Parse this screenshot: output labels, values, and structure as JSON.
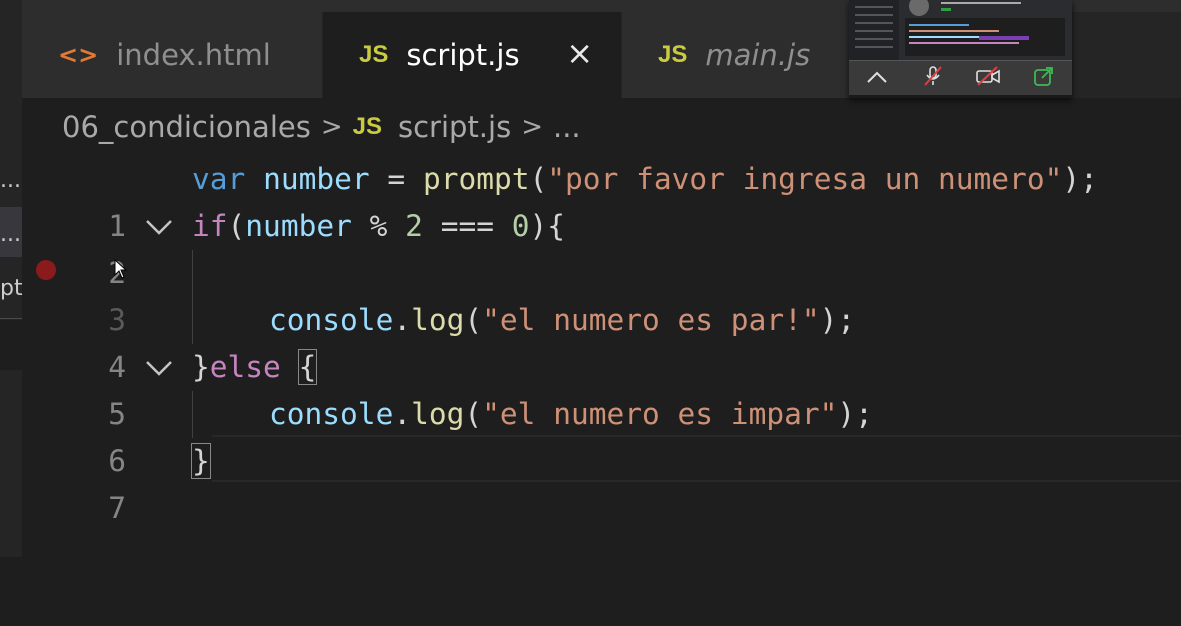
{
  "sidebar": {
    "items": [
      {
        "label": "..."
      },
      {
        "label": "..."
      },
      {
        "label": "pt"
      }
    ]
  },
  "tabs": [
    {
      "label": "index.html",
      "icon": "html-file-icon",
      "glyph": "<>"
    },
    {
      "label": "script.js",
      "icon": "js-file-icon",
      "glyph": "JS",
      "active": true,
      "close": "×"
    },
    {
      "label": "main.js",
      "icon": "js-file-icon",
      "glyph": "JS"
    }
  ],
  "breadcrumb": {
    "folder": "06_condicionales",
    "sep1": ">",
    "file_icon": "JS",
    "file": "script.js",
    "sep2": ">",
    "more": "..."
  },
  "editor": {
    "line_numbers": [
      "1",
      "2",
      "3",
      "4",
      "5",
      "6",
      "7"
    ],
    "lines": {
      "l1": {
        "kw": "var",
        "v1": "number",
        "op": " = ",
        "fn": "prompt",
        "p1": "(",
        "str": "\"por favor ingresa un numero\"",
        "p2": ");"
      },
      "l2": {
        "kw": "if",
        "p1": "(",
        "v1": "number",
        "op1": " % ",
        "n1": "2",
        "op2": " === ",
        "n2": "0",
        "p2": "){"
      },
      "l4": {
        "obj": "console",
        "dot": ".",
        "fn": "log",
        "p1": "(",
        "str": "\"el numero es par!\"",
        "p2": ");"
      },
      "l5": {
        "b1": "}",
        "kw": "else",
        "sp": " ",
        "b2": "{"
      },
      "l6": {
        "obj": "console",
        "dot": ".",
        "fn": "log",
        "p1": "(",
        "str": "\"el numero es impar\"",
        "p2": ");"
      },
      "l7": {
        "b1": "}"
      }
    },
    "fold_glyph": "⌄"
  },
  "video_thumbnail": {
    "controls": [
      "chevron-up-icon",
      "mic-off-icon",
      "camera-off-icon",
      "share-screen-icon"
    ]
  },
  "colors": {
    "keyword": "#569cd6",
    "control": "#c586c0",
    "variable": "#9cdcfe",
    "function": "#dcdcaa",
    "string": "#ce9178",
    "number": "#b5cea8",
    "js_icon": "#cbcb41",
    "html_icon": "#e37933",
    "breakpoint": "#8b1a1a"
  }
}
